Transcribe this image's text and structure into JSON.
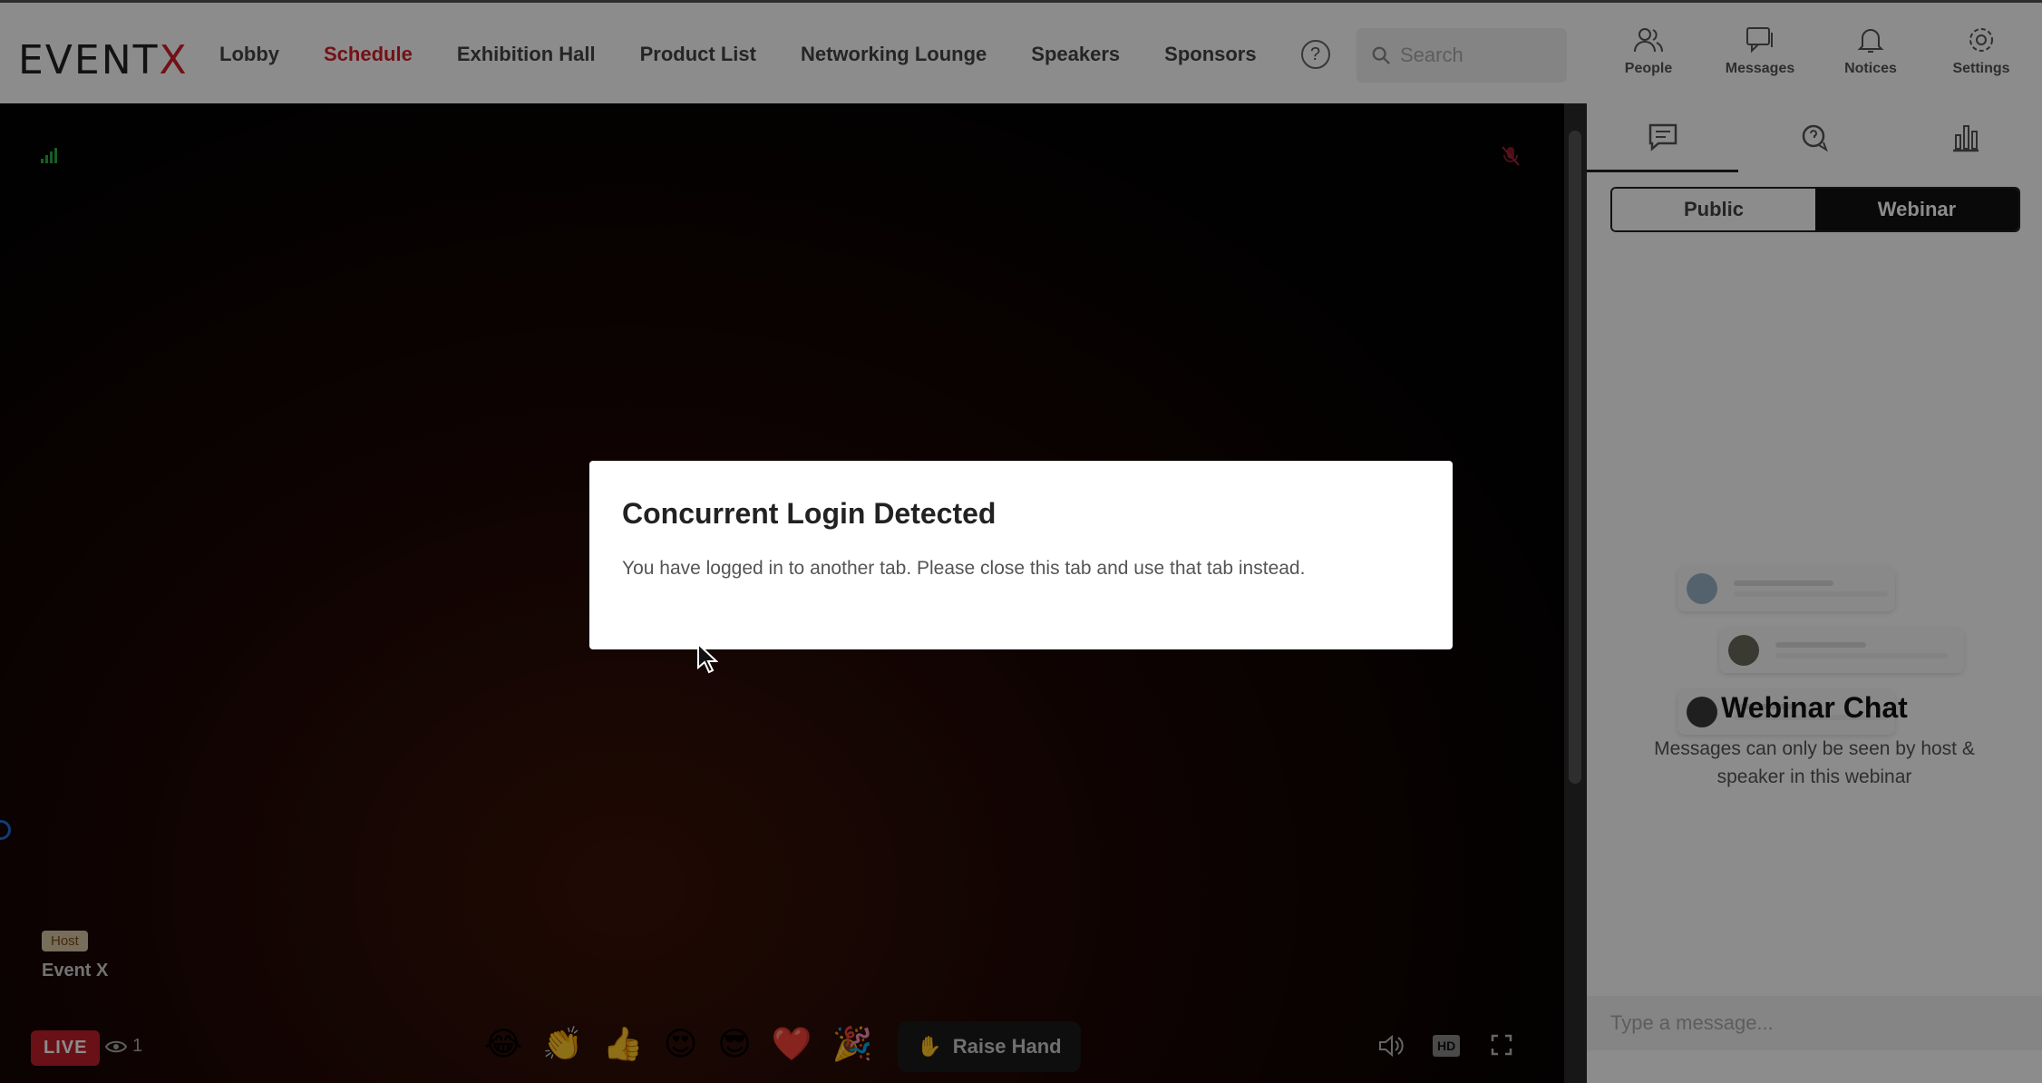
{
  "header": {
    "logo_main": "EVENT",
    "logo_accent": "X",
    "nav": [
      {
        "label": "Lobby",
        "active": false
      },
      {
        "label": "Schedule",
        "active": true
      },
      {
        "label": "Exhibition Hall",
        "active": false
      },
      {
        "label": "Product List",
        "active": false
      },
      {
        "label": "Networking Lounge",
        "active": false
      },
      {
        "label": "Speakers",
        "active": false
      },
      {
        "label": "Sponsors",
        "active": false
      }
    ],
    "help_glyph": "?",
    "search_placeholder": "Search",
    "icons": {
      "people": "People",
      "messages": "Messages",
      "notices": "Notices",
      "settings": "Settings"
    }
  },
  "video": {
    "host_badge": "Host",
    "host_name": "Event X",
    "live_label": "LIVE",
    "viewer_count": "1",
    "emojis": [
      "😂",
      "👏",
      "👍",
      "😍",
      "😎",
      "❤️",
      "🎉"
    ],
    "raise_hand": "Raise Hand",
    "hd_label": "HD"
  },
  "panel": {
    "toggle_public": "Public",
    "toggle_webinar": "Webinar",
    "chat_title": "Webinar Chat",
    "chat_subtitle": "Messages can only be seen by host & speaker in this webinar",
    "message_placeholder": "Type a message..."
  },
  "modal": {
    "title": "Concurrent Login Detected",
    "body": "You have logged in to another tab. Please close this tab and use that tab instead."
  },
  "colors": {
    "accent": "#d0202a",
    "live": "#c1202a"
  }
}
